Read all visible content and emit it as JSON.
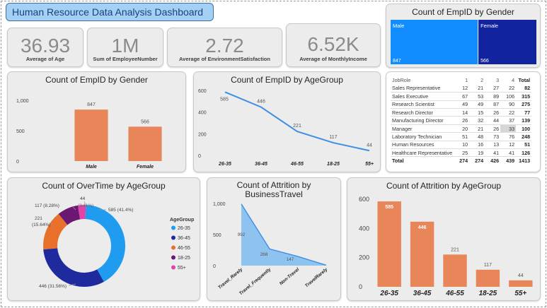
{
  "header": {
    "title": "Human Resource Data Analysis Dashboard"
  },
  "kpis": [
    {
      "value": "36.93",
      "label": "Average of Age"
    },
    {
      "value": "1M",
      "label": "Sum of EmployeeNumber"
    },
    {
      "value": "2.72",
      "label": "Average of EnvironmentSatisfaction"
    },
    {
      "value": "6.52K",
      "label": "Average of MonthlyIncome"
    }
  ],
  "colors": {
    "bar": "#e8865a",
    "line": "#3f8ee6",
    "male": "#118dff",
    "female": "#12239e",
    "age_26_35": "#1f9cf0",
    "age_36_45": "#1e2a9e",
    "age_46_55": "#e8702a",
    "age_18_25": "#6b1873",
    "age_55_plus": "#e044a7",
    "area": "#7fbcf0"
  },
  "chart_data": [
    {
      "id": "treemap_gender",
      "type": "treemap",
      "title": "Count of EmpID by Gender",
      "categories": [
        "Male",
        "Female"
      ],
      "values": [
        847,
        566
      ]
    },
    {
      "id": "bar_gender",
      "type": "bar",
      "title": "Count of EmpID by Gender",
      "categories": [
        "Male",
        "Female"
      ],
      "values": [
        847,
        566
      ],
      "ylim": [
        0,
        1000
      ],
      "yticks": [
        "0",
        "500",
        "1,000"
      ],
      "tick_values": [
        0,
        500,
        1000
      ]
    },
    {
      "id": "line_age",
      "type": "line",
      "title": "Count of EmpID by AgeGroup",
      "categories": [
        "26-35",
        "36-45",
        "46-55",
        "18-25",
        "55+"
      ],
      "values": [
        585,
        446,
        221,
        117,
        44
      ],
      "ylim": [
        0,
        600
      ],
      "yticks": [
        "0",
        "200",
        "400",
        "600"
      ],
      "tick_values": [
        0,
        200,
        400,
        600
      ]
    },
    {
      "id": "table_jobrole",
      "type": "table",
      "columns": [
        "JobRole",
        "1",
        "2",
        "3",
        "4",
        "Total"
      ],
      "rows": [
        [
          "Sales Representative",
          "12",
          "21",
          "27",
          "22",
          "82"
        ],
        [
          "Sales Executive",
          "67",
          "53",
          "89",
          "106",
          "315"
        ],
        [
          "Research Scientist",
          "49",
          "49",
          "87",
          "90",
          "275"
        ],
        [
          "Research Director",
          "14",
          "15",
          "26",
          "22",
          "77"
        ],
        [
          "Manufacturing Director",
          "26",
          "32",
          "44",
          "37",
          "139"
        ],
        [
          "Manager",
          "20",
          "21",
          "26",
          "33",
          "100"
        ],
        [
          "Laboratory Technician",
          "51",
          "48",
          "73",
          "76",
          "248"
        ],
        [
          "Human Resources",
          "10",
          "16",
          "13",
          "12",
          "51"
        ],
        [
          "Healthcare Representative",
          "25",
          "19",
          "41",
          "41",
          "126"
        ]
      ],
      "total_row": [
        "Total",
        "274",
        "274",
        "426",
        "439",
        "1413"
      ]
    },
    {
      "id": "donut_overtime",
      "type": "pie",
      "title": "Count of OverTime by AgeGroup",
      "legend_title": "AgeGroup",
      "categories": [
        "26-35",
        "36-45",
        "46-55",
        "18-25",
        "55+"
      ],
      "values": [
        585,
        446,
        221,
        117,
        44
      ],
      "labels": [
        "585 (41.4%)",
        "446 (31.56%)",
        "221 (15.64%)",
        "117 (8.28%)",
        "44"
      ],
      "small_label": "(3.11%)"
    },
    {
      "id": "area_travel",
      "type": "area",
      "title": "Count of Attrition by BusinessTravel",
      "categories": [
        "Travel_Rarely",
        "Travel_Frequently",
        "Non-Travel",
        "TravelRarely"
      ],
      "values": [
        992,
        268,
        147,
        6
      ],
      "data_labels": [
        "992",
        "268",
        "147",
        ""
      ],
      "ylim": [
        0,
        1000
      ],
      "yticks": [
        "0",
        "500",
        "1,000"
      ],
      "tick_values": [
        0,
        500,
        1000
      ]
    },
    {
      "id": "bar_attrition_age",
      "type": "bar",
      "title": "Count of Attrition by AgeGroup",
      "categories": [
        "26-35",
        "36-45",
        "46-55",
        "18-25",
        "55+"
      ],
      "values": [
        585,
        446,
        221,
        117,
        44
      ],
      "ylim": [
        0,
        600
      ],
      "yticks": [
        "0",
        "200",
        "400",
        "600"
      ],
      "tick_values": [
        0,
        200,
        400,
        600
      ]
    }
  ]
}
